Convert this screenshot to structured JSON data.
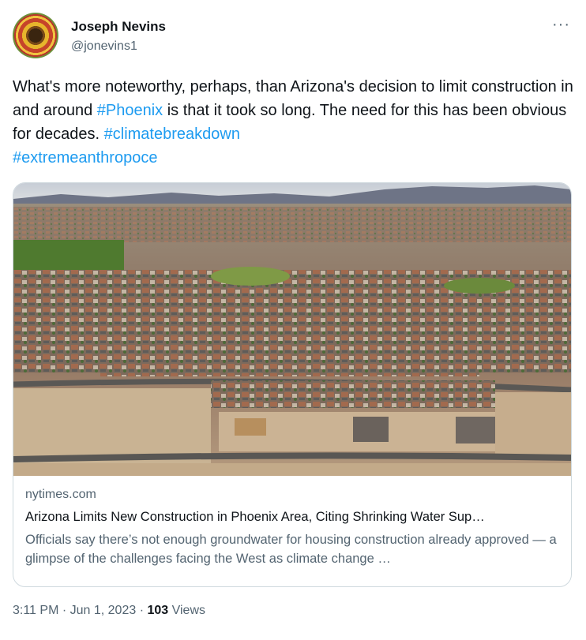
{
  "author": {
    "name": "Joseph Nevins",
    "handle": "@jonevins1"
  },
  "more_icon": "···",
  "tweet": {
    "text_before_tag1": "What's more noteworthy, perhaps, than Arizona's decision to limit construction in and around ",
    "tag1": "#Phoenix",
    "text_after_tag1": " is that it took so long. The need for this has been obvious for decades. ",
    "tag2": "#climatebreakdown",
    "tag3": "#extremeanthropoce"
  },
  "card": {
    "domain": "nytimes.com",
    "title": "Arizona Limits New Construction in Phoenix Area, Citing Shrinking Water Sup…",
    "description": "Officials say there’s not enough groundwater for housing construction already approved — a glimpse of the challenges facing the West as climate change …"
  },
  "footer": {
    "time": "3:11 PM · Jun 1, 2023 · ",
    "views_count": "103",
    "views_label": " Views"
  },
  "colors": {
    "link": "#1d9bf0",
    "secondary_text": "#536471",
    "border": "#cfd9de"
  }
}
